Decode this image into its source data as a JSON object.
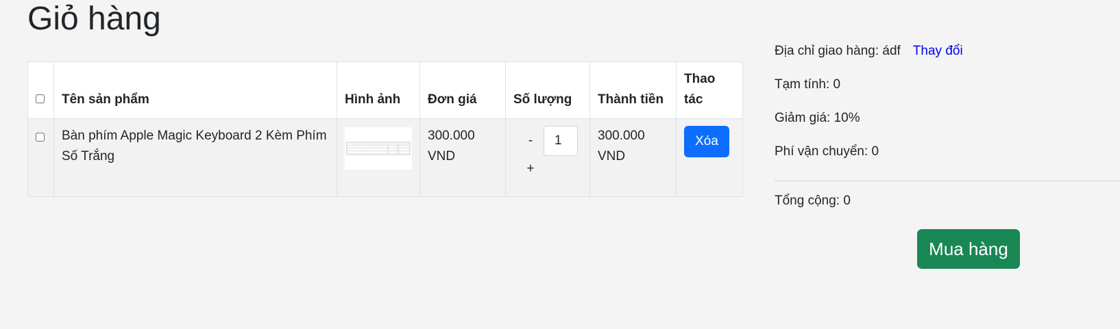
{
  "page": {
    "title": "Giỏ hàng"
  },
  "table": {
    "headers": {
      "name": "Tên sản phẩm",
      "image": "Hình ảnh",
      "price": "Đơn giá",
      "quantity": "Số lượng",
      "total": "Thành tiền",
      "action": "Thao tác"
    },
    "rows": [
      {
        "name": "Bàn phím Apple Magic Keyboard 2 Kèm Phím Số Trắng",
        "image_icon": "keyboard-image",
        "price": "300.000 VND",
        "decrement": "-",
        "quantity": "1",
        "increment": "+",
        "total": "300.000 VND",
        "delete_label": "Xóa"
      }
    ]
  },
  "summary": {
    "address_label": "Địa chỉ giao hàng: ádf",
    "change_link": "Thay đổi",
    "subtotal": "Tạm tính: 0",
    "discount": "Giảm giá: 10%",
    "shipping": "Phí vận chuyển: 0",
    "grand_total": "Tổng cộng: 0",
    "buy_label": "Mua hàng"
  },
  "colors": {
    "background": "#f4f4f4",
    "delete_button": "#0d6efd",
    "buy_button": "#198754",
    "link": "#0000ee"
  }
}
